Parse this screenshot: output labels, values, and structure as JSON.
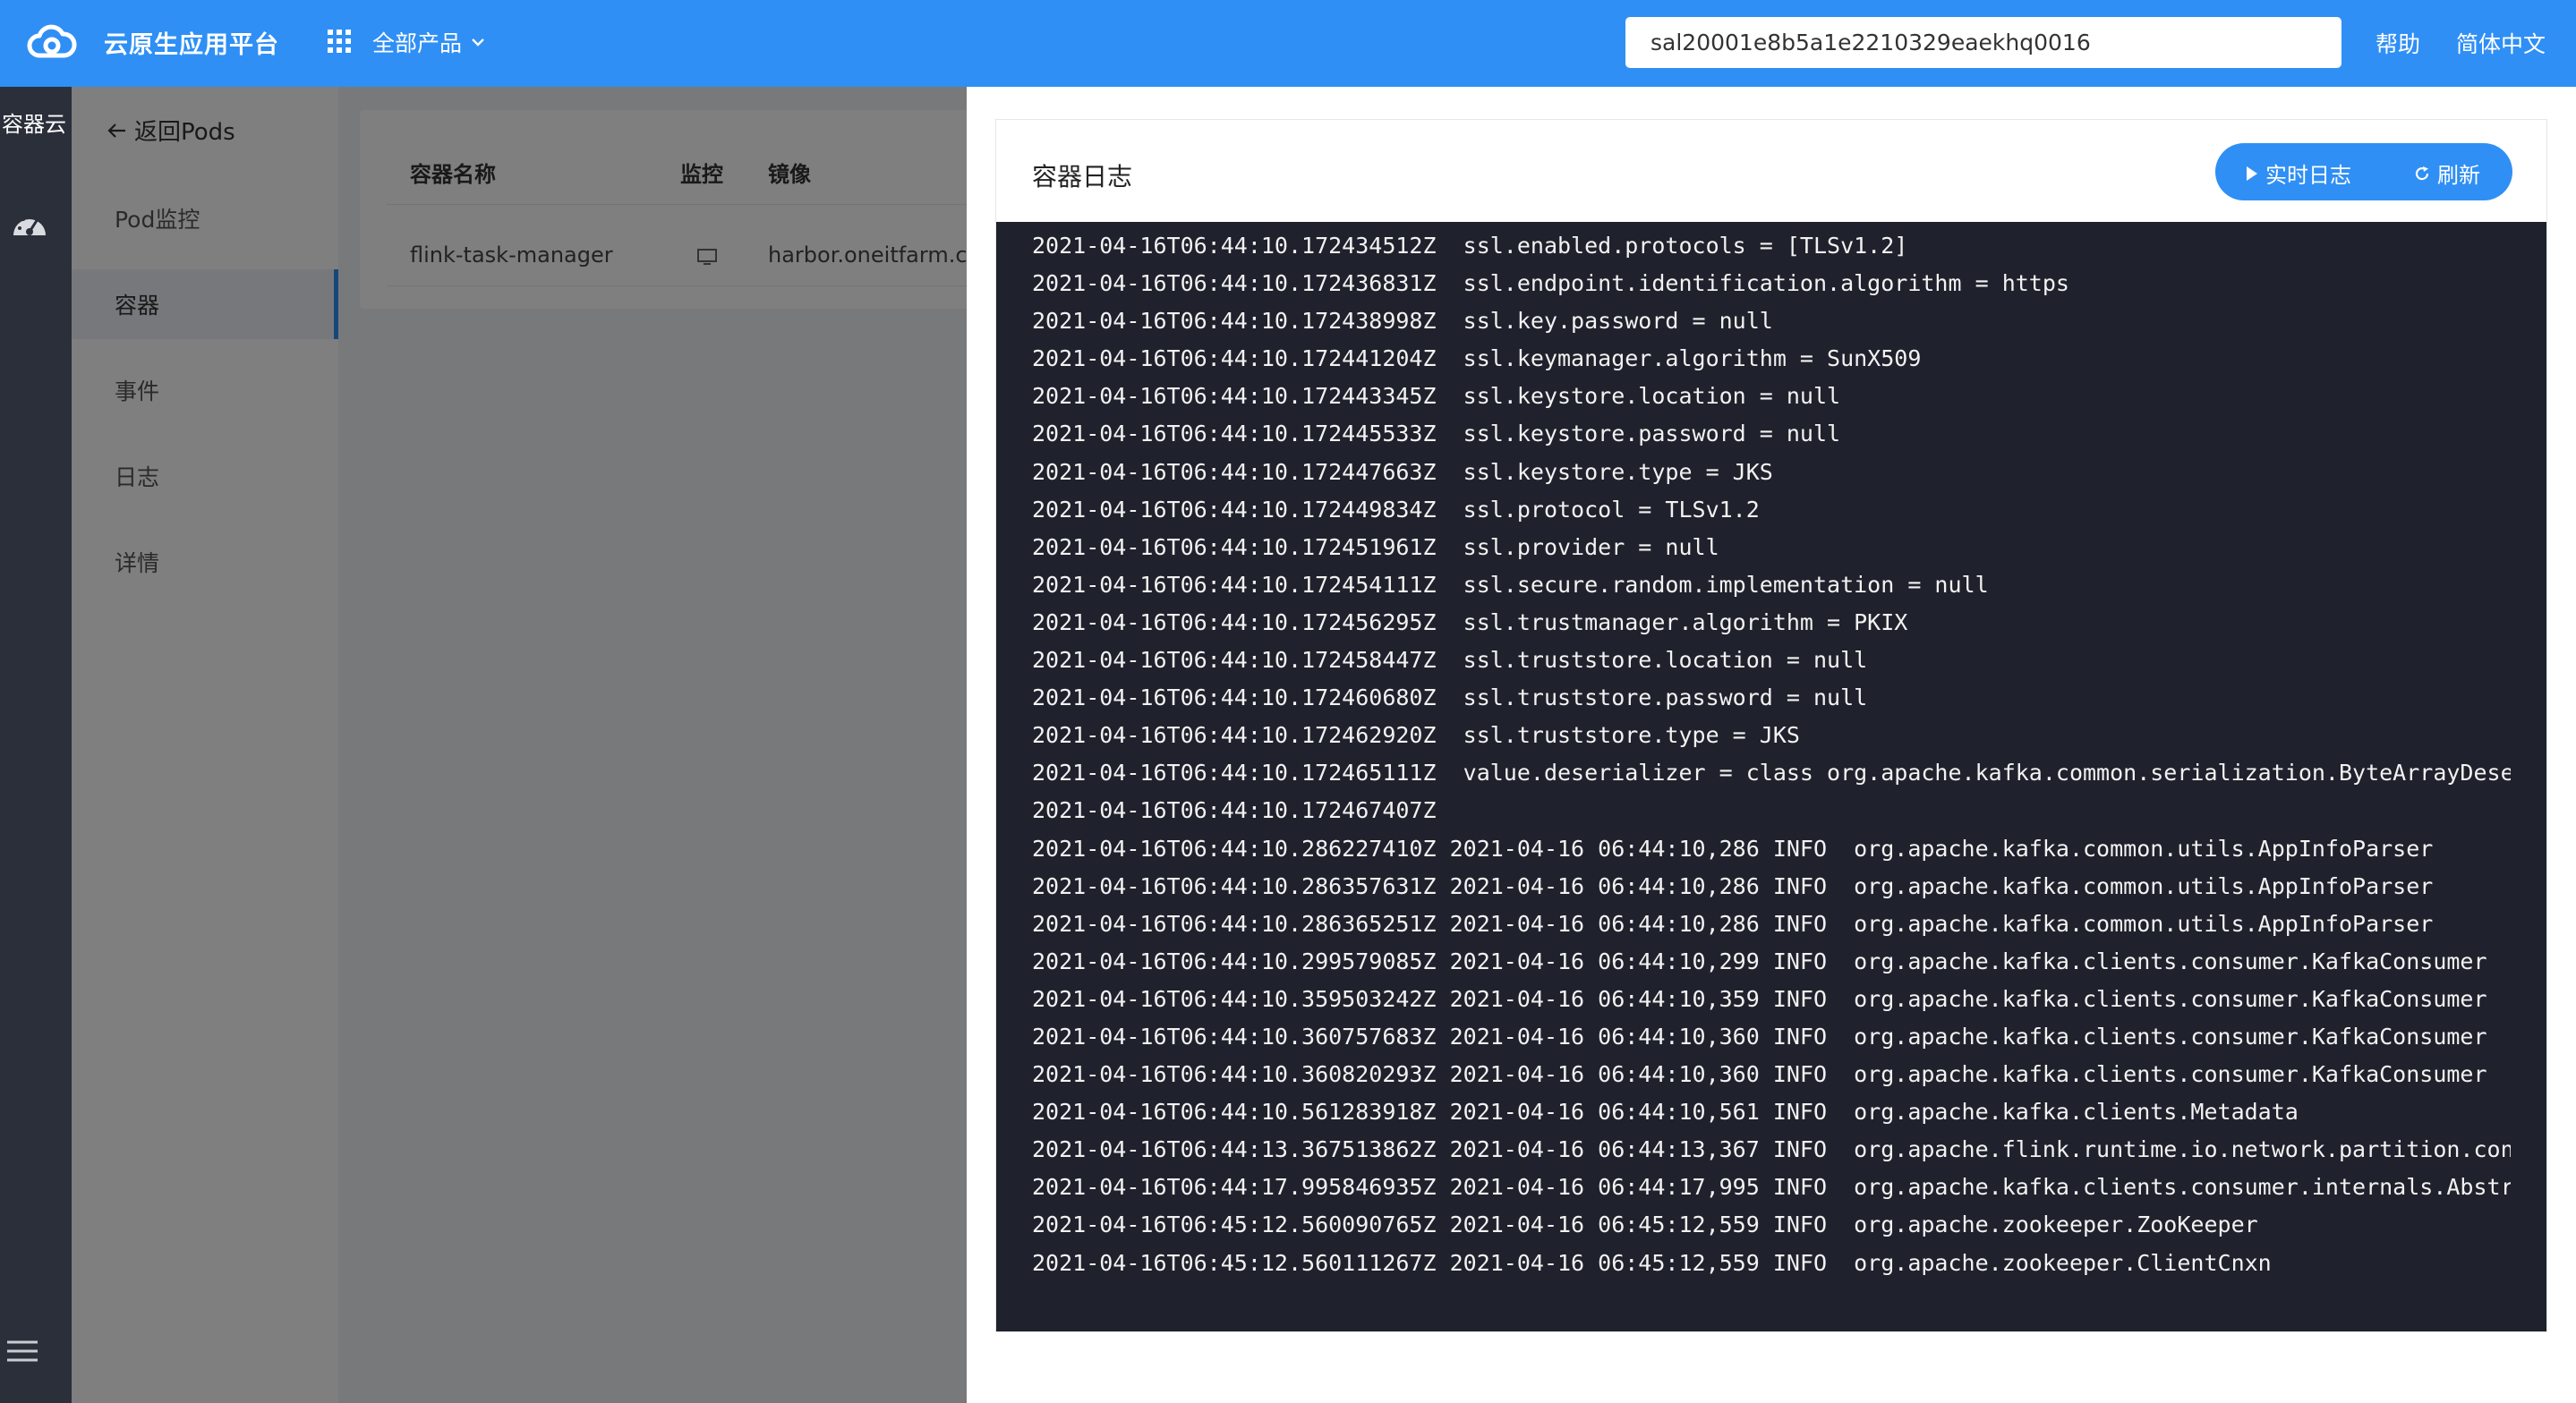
{
  "header": {
    "app_title": "云原生应用平台",
    "all_products_label": "全部产品",
    "search_value": "sal20001e8b5a1e2210329eaekhq0016",
    "help_label": "帮助",
    "lang_label": "简体中文"
  },
  "rail": {
    "title": "容器云"
  },
  "subnav": {
    "back_label": "返回Pods",
    "items": [
      {
        "label": "Pod监控"
      },
      {
        "label": "容器"
      },
      {
        "label": "事件"
      },
      {
        "label": "日志"
      },
      {
        "label": "详情"
      }
    ]
  },
  "container_table": {
    "headers": [
      "容器名称",
      "监控",
      "镜像"
    ],
    "row": {
      "name": "flink-task-manager",
      "image": "harbor.oneitfarm.co"
    }
  },
  "log_drawer": {
    "title": "容器日志",
    "live_label": "实时日志",
    "refresh_label": "刷新",
    "lines": [
      "2021-04-16T06:44:10.172434512Z  ssl.enabled.protocols = [TLSv1.2]",
      "2021-04-16T06:44:10.172436831Z  ssl.endpoint.identification.algorithm = https",
      "2021-04-16T06:44:10.172438998Z  ssl.key.password = null",
      "2021-04-16T06:44:10.172441204Z  ssl.keymanager.algorithm = SunX509",
      "2021-04-16T06:44:10.172443345Z  ssl.keystore.location = null",
      "2021-04-16T06:44:10.172445533Z  ssl.keystore.password = null",
      "2021-04-16T06:44:10.172447663Z  ssl.keystore.type = JKS",
      "2021-04-16T06:44:10.172449834Z  ssl.protocol = TLSv1.2",
      "2021-04-16T06:44:10.172451961Z  ssl.provider = null",
      "2021-04-16T06:44:10.172454111Z  ssl.secure.random.implementation = null",
      "2021-04-16T06:44:10.172456295Z  ssl.trustmanager.algorithm = PKIX",
      "2021-04-16T06:44:10.172458447Z  ssl.truststore.location = null",
      "2021-04-16T06:44:10.172460680Z  ssl.truststore.password = null",
      "2021-04-16T06:44:10.172462920Z  ssl.truststore.type = JKS",
      "2021-04-16T06:44:10.172465111Z  value.deserializer = class org.apache.kafka.common.serialization.ByteArrayDeserial:",
      "2021-04-16T06:44:10.172467407Z",
      "2021-04-16T06:44:10.286227410Z 2021-04-16 06:44:10,286 INFO  org.apache.kafka.common.utils.AppInfoParser",
      "2021-04-16T06:44:10.286357631Z 2021-04-16 06:44:10,286 INFO  org.apache.kafka.common.utils.AppInfoParser",
      "2021-04-16T06:44:10.286365251Z 2021-04-16 06:44:10,286 INFO  org.apache.kafka.common.utils.AppInfoParser",
      "2021-04-16T06:44:10.299579085Z 2021-04-16 06:44:10,299 INFO  org.apache.kafka.clients.consumer.KafkaConsumer",
      "2021-04-16T06:44:10.359503242Z 2021-04-16 06:44:10,359 INFO  org.apache.kafka.clients.consumer.KafkaConsumer",
      "2021-04-16T06:44:10.360757683Z 2021-04-16 06:44:10,360 INFO  org.apache.kafka.clients.consumer.KafkaConsumer",
      "2021-04-16T06:44:10.360820293Z 2021-04-16 06:44:10,360 INFO  org.apache.kafka.clients.consumer.KafkaConsumer",
      "2021-04-16T06:44:10.561283918Z 2021-04-16 06:44:10,561 INFO  org.apache.kafka.clients.Metadata",
      "2021-04-16T06:44:13.367513862Z 2021-04-16 06:44:13,367 INFO  org.apache.flink.runtime.io.network.partition.consume",
      "2021-04-16T06:44:17.995846935Z 2021-04-16 06:44:17,995 INFO  org.apache.kafka.clients.consumer.internals.AbstractC",
      "2021-04-16T06:45:12.560090765Z 2021-04-16 06:45:12,559 INFO  org.apache.zookeeper.ZooKeeper",
      "2021-04-16T06:45:12.560111267Z 2021-04-16 06:45:12,559 INFO  org.apache.zookeeper.ClientCnxn"
    ]
  },
  "colors": {
    "topbar": "#2f8ff5",
    "rail": "#2b2f3a",
    "terminal_bg": "#1f222c",
    "accent": "#2f8ff5"
  },
  "icons": [
    "cloud-logo-icon",
    "apps-grid-icon",
    "chevron-down-icon",
    "dashboard-gauge-icon",
    "hamburger-menu-icon",
    "arrow-left-icon",
    "monitor-icon",
    "play-icon",
    "refresh-icon"
  ]
}
